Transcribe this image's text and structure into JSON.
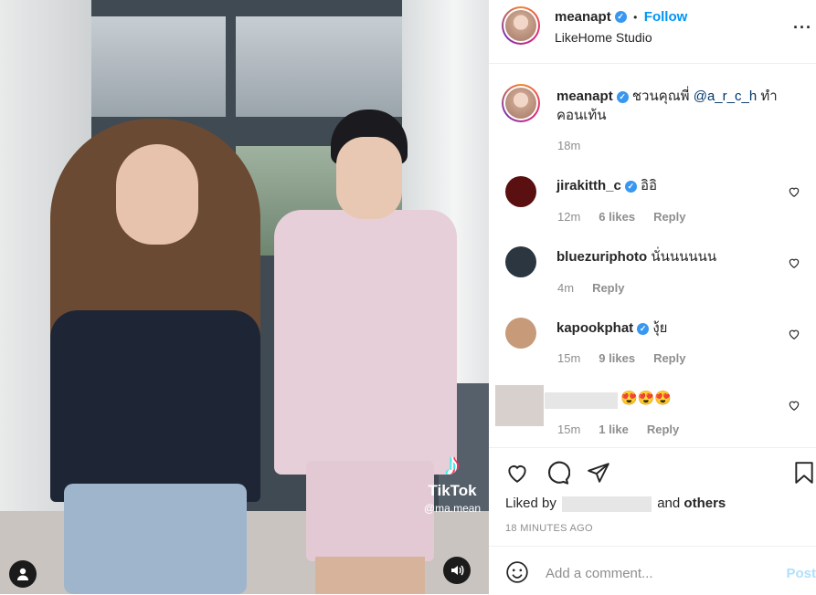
{
  "media": {
    "watermark_brand": "TikTok",
    "watermark_handle": "@ma.mean"
  },
  "header": {
    "username": "meanapt",
    "follow_label": "Follow",
    "separator": "•",
    "location": "LikeHome Studio",
    "more_glyph": "···"
  },
  "caption": {
    "username": "meanapt",
    "text_before": "ชวนคุณพี่ ",
    "mention": "@a_r_c_h",
    "text_after": " ทำคอนเท้น",
    "time": "18m"
  },
  "comments": [
    {
      "username": "jirakitth_c",
      "verified": true,
      "text": "อิอิ",
      "time": "12m",
      "likes": "6 likes",
      "reply": "Reply",
      "avatar_color": "#5a1010"
    },
    {
      "username": "bluezuriphoto",
      "verified": false,
      "text": "นั่นนนนนน",
      "time": "4m",
      "likes": "",
      "reply": "Reply",
      "avatar_color": "#2c3640"
    },
    {
      "username": "kapookphat",
      "verified": true,
      "text": "งุ้ย",
      "time": "15m",
      "likes": "9 likes",
      "reply": "Reply",
      "avatar_color": "#c79a7a"
    },
    {
      "username": "",
      "verified": false,
      "text": "😍😍😍",
      "time": "15m",
      "likes": "1 like",
      "reply": "Reply",
      "avatar_color": "#d8d0cc"
    }
  ],
  "likes": {
    "prefix": "Liked by",
    "and_text": "and",
    "others": "others"
  },
  "timestamp": "18 MINUTES AGO",
  "add_comment": {
    "placeholder": "Add a comment...",
    "post_label": "Post"
  },
  "colors": {
    "accent": "#0095f6",
    "verified": "#3897f0",
    "meta": "#8e8e8e"
  }
}
